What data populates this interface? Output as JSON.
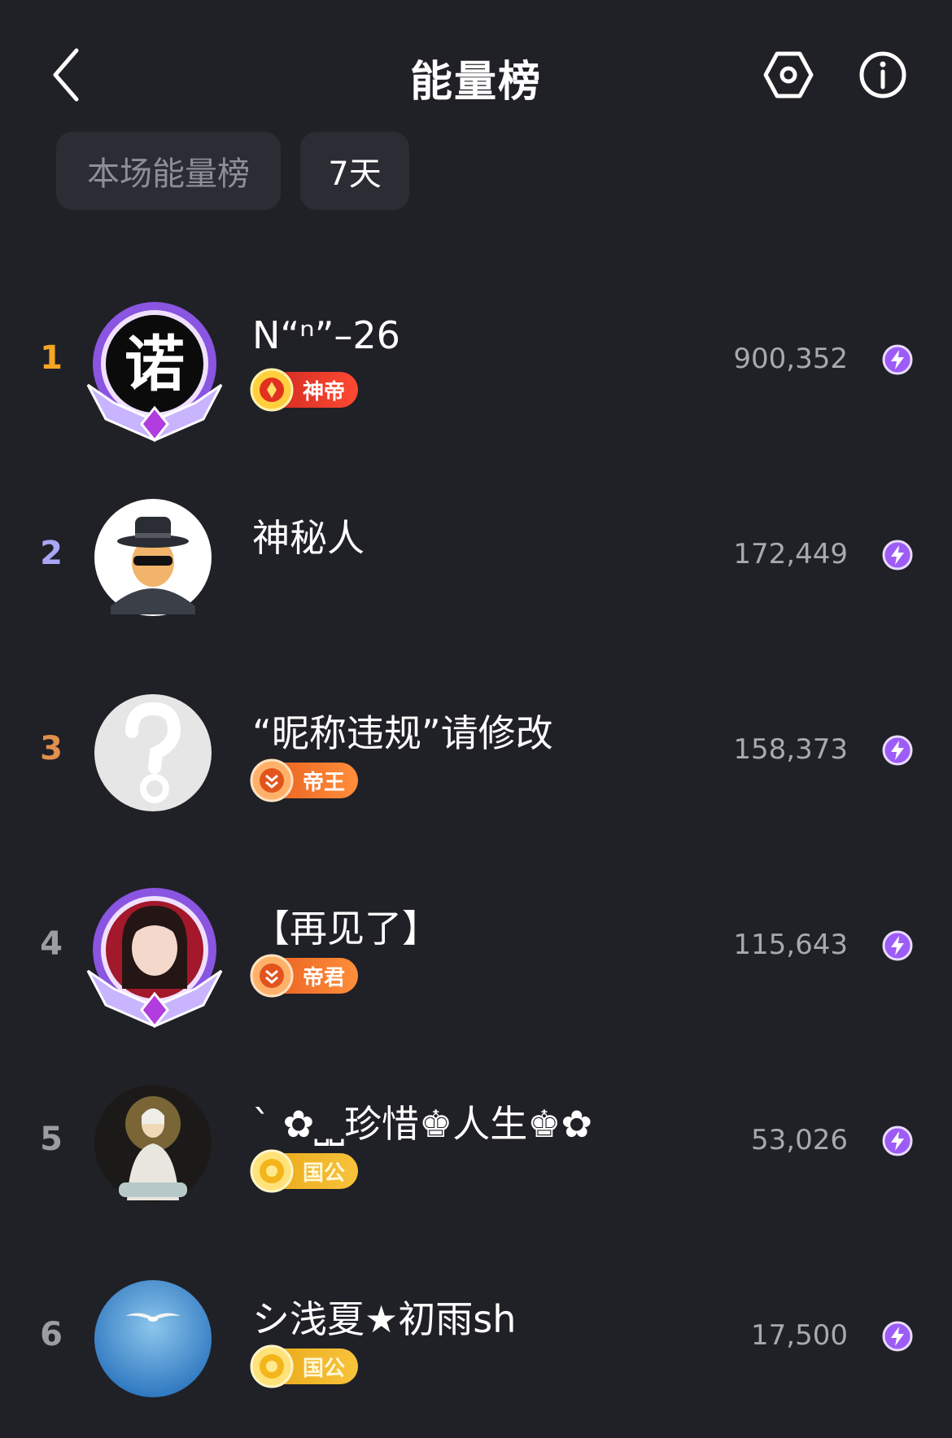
{
  "header": {
    "title": "能量榜",
    "back_icon": "chevron-left-icon",
    "settings_icon": "hexagon-settings-icon",
    "info_icon": "info-circle-icon"
  },
  "tabs": [
    {
      "label": "本场能量榜",
      "selected": false
    },
    {
      "label": "7天",
      "selected": true
    }
  ],
  "colors": {
    "background": "#202027",
    "tab_bg": "#2c2c35",
    "rank_gold": "#f5a623",
    "rank_silver": "#a9a7f5",
    "rank_bronze": "#e0904c",
    "energy_icon": "#9d5cf5"
  },
  "ranking": [
    {
      "rank": "1",
      "name": "N“ⁿ”–26",
      "badge": "神帝",
      "score": "900,352",
      "avatar": "avatar-calligraphy"
    },
    {
      "rank": "2",
      "name": "神秘人",
      "badge": "",
      "score": "172,449",
      "avatar": "avatar-mystery-man"
    },
    {
      "rank": "3",
      "name": "“昵称违规”请修改",
      "badge": "帝王",
      "score": "158,373",
      "avatar": "avatar-question-mark"
    },
    {
      "rank": "4",
      "name": "【再见了】",
      "badge": "帝君",
      "score": "115,643",
      "avatar": "avatar-woman-photo"
    },
    {
      "rank": "5",
      "name": "`  ✿⎵⎵珍惜♚人生♚✿",
      "badge": "国公",
      "score": "53,026",
      "avatar": "avatar-bodhisattva"
    },
    {
      "rank": "6",
      "name": "シ浅夏★初雨sh",
      "badge": "国公",
      "score": "17,500",
      "avatar": "avatar-sky-bird"
    }
  ]
}
